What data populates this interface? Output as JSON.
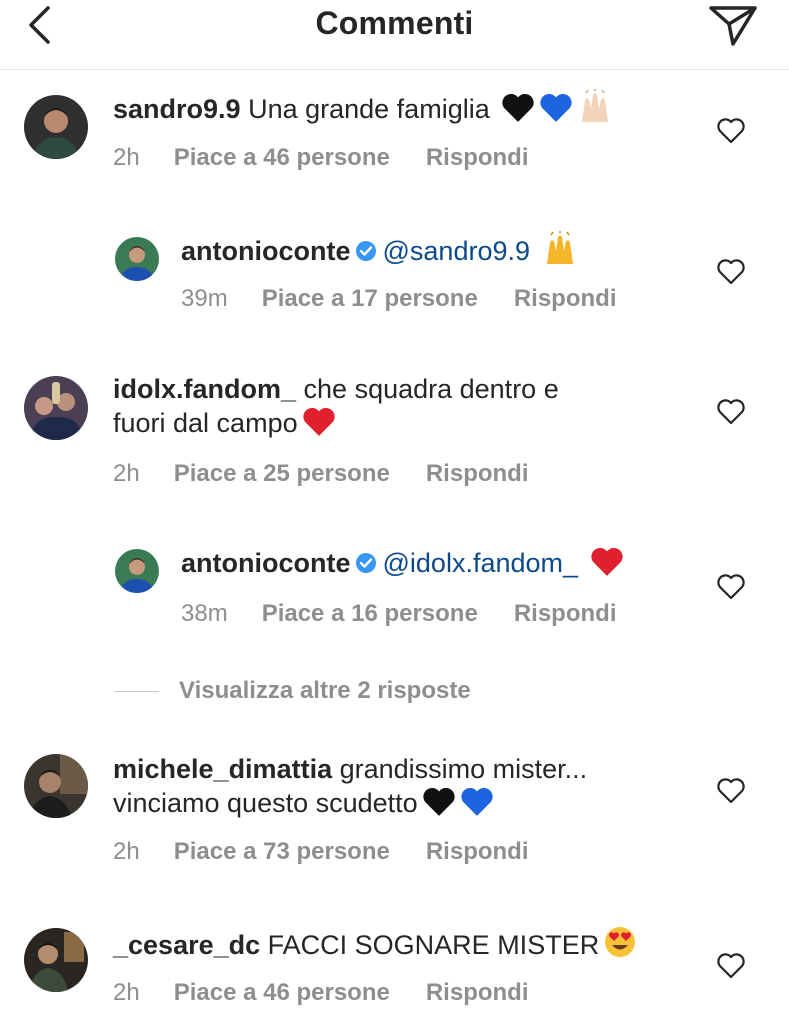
{
  "header": {
    "title": "Commenti",
    "back_icon": "chevron-left-icon",
    "send_icon": "paper-plane-icon"
  },
  "comments": [
    {
      "username": "sandro9.9",
      "text": "Una grande famiglia",
      "emojis": [
        "black-heart",
        "blue-heart",
        "raising-hands"
      ],
      "time": "2h",
      "likes": "Piace a 46 persone",
      "reply": "Rispondi"
    },
    {
      "username": "antonioconte",
      "verified": true,
      "mention": "@sandro9.9",
      "emojis": [
        "raising-hands"
      ],
      "time": "39m",
      "likes": "Piace a 17 persone",
      "reply": "Rispondi"
    },
    {
      "username": "idolx.fandom_",
      "text_line1": "che squadra dentro e",
      "text_line2": "fuori dal campo",
      "emojis": [
        "red-heart"
      ],
      "time": "2h",
      "likes": "Piace a 25 persone",
      "reply": "Rispondi"
    },
    {
      "username": "antonioconte",
      "verified": true,
      "mention": "@idolx.fandom_",
      "emojis": [
        "red-heart"
      ],
      "time": "38m",
      "likes": "Piace a 16 persone",
      "reply": "Rispondi"
    },
    {
      "username": "michele_dimattia",
      "text_line1": "grandissimo mister...",
      "text_line2": "vinciamo questo scudetto",
      "emojis": [
        "black-heart",
        "blue-heart"
      ],
      "time": "2h",
      "likes": "Piace a 73 persone",
      "reply": "Rispondi"
    },
    {
      "username": "_cesare_dc",
      "text": "FACCI SOGNARE MISTER",
      "emojis": [
        "heart-eyes-face"
      ],
      "time": "2h",
      "likes": "Piace a 46 persone",
      "reply": "Rispondi"
    }
  ],
  "more_replies": "Visualizza altre 2 risposte",
  "colors": {
    "text": "#262626",
    "meta": "#8e8e8e",
    "mention": "#0d4a8c",
    "verified": "#3897f0",
    "divider": "#e6e6e6"
  }
}
